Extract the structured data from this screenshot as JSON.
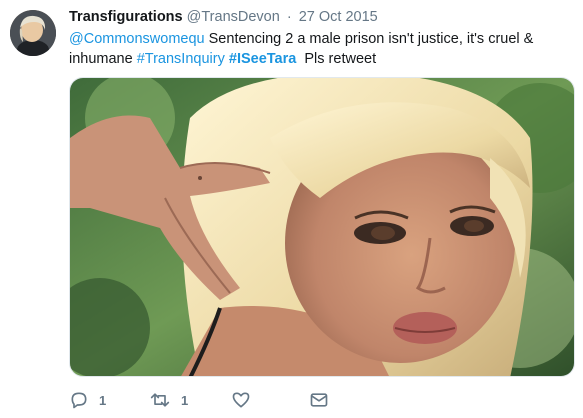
{
  "tweet": {
    "display_name": "Transfigurations",
    "handle": "@TransDevon",
    "separator": "·",
    "date": "27 Oct 2015",
    "text": {
      "mention": "@Commonswomequ",
      "part1": " Sentencing 2 a male prison isn't justice, it's cruel & inhumane ",
      "hashtag1": "#TransInquiry",
      "space": " ",
      "hashtag2": "#ISeeTara",
      "part2": "  Pls retweet"
    }
  },
  "actions": {
    "reply_count": "1",
    "retweet_count": "1",
    "like_count": "",
    "icons": [
      "reply-icon",
      "retweet-icon",
      "like-icon",
      "message-icon"
    ]
  },
  "colors": {
    "link": "#1b95e0",
    "text": "#14171a",
    "muted": "#657786"
  }
}
